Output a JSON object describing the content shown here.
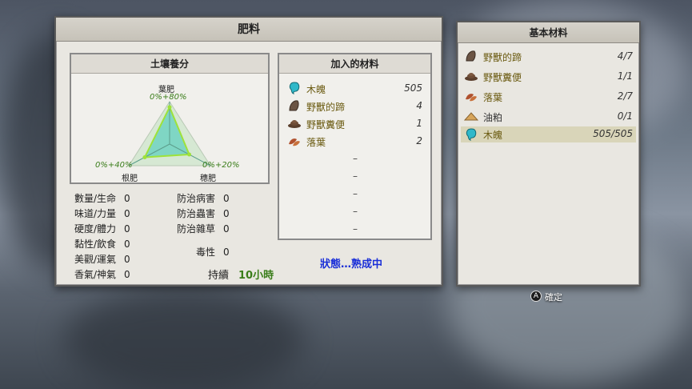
{
  "main_panel": {
    "title": "肥料",
    "soil": {
      "title": "土壤養分",
      "labels": {
        "top": "葉肥",
        "top_value": "0%+80%",
        "left": "根肥",
        "left_value": "0%+40%",
        "right": "穗肥",
        "right_value": "0%+20%"
      },
      "chart_data": {
        "type": "radar",
        "axes": [
          "葉肥",
          "穗肥",
          "根肥"
        ],
        "series": [
          {
            "values": [
              80,
              20,
              40
            ]
          }
        ],
        "scale_max": 100
      }
    },
    "stats_left": [
      {
        "label": "數量/生命",
        "value": "0"
      },
      {
        "label": "味道/力量",
        "value": "0"
      },
      {
        "label": "硬度/體力",
        "value": "0"
      },
      {
        "label": "黏性/飲食",
        "value": "0"
      },
      {
        "label": "美觀/運氣",
        "value": "0"
      },
      {
        "label": "香氣/神氣",
        "value": "0"
      }
    ],
    "stats_right": [
      {
        "label": "防治病害",
        "value": "0"
      },
      {
        "label": "防治蟲害",
        "value": "0"
      },
      {
        "label": "防治雜草",
        "value": "0"
      }
    ],
    "toxicity": {
      "label": "毒性",
      "value": "0"
    },
    "duration": {
      "label": "持續",
      "value": "10小時"
    },
    "added": {
      "title": "加入的材料",
      "items": [
        {
          "name": "木魄",
          "qty": "505",
          "icon": "blue-spirit-icon"
        },
        {
          "name": "野獸的蹄",
          "qty": "4",
          "icon": "hoof-icon"
        },
        {
          "name": "野獸糞便",
          "qty": "1",
          "icon": "dung-icon"
        },
        {
          "name": "落葉",
          "qty": "2",
          "icon": "leaves-icon"
        }
      ],
      "empty_slot": "–"
    },
    "status": "狀態…熟成中"
  },
  "side_panel": {
    "title": "基本材料",
    "items": [
      {
        "name": "野獸的蹄",
        "qty": "4/7",
        "icon": "hoof-icon"
      },
      {
        "name": "野獸糞便",
        "qty": "1/1",
        "icon": "dung-icon"
      },
      {
        "name": "落葉",
        "qty": "2/7",
        "icon": "leaves-icon"
      },
      {
        "name": "油粕",
        "qty": "0/1",
        "icon": "oil-cake-icon"
      },
      {
        "name": "木魄",
        "qty": "505/505",
        "icon": "blue-spirit-icon"
      }
    ],
    "confirm": {
      "button": "A",
      "label": "確定"
    }
  },
  "colors": {
    "accent_green": "#3a7d1a",
    "status_blue": "#1a2fd8",
    "item_gold": "#6a5a10"
  }
}
